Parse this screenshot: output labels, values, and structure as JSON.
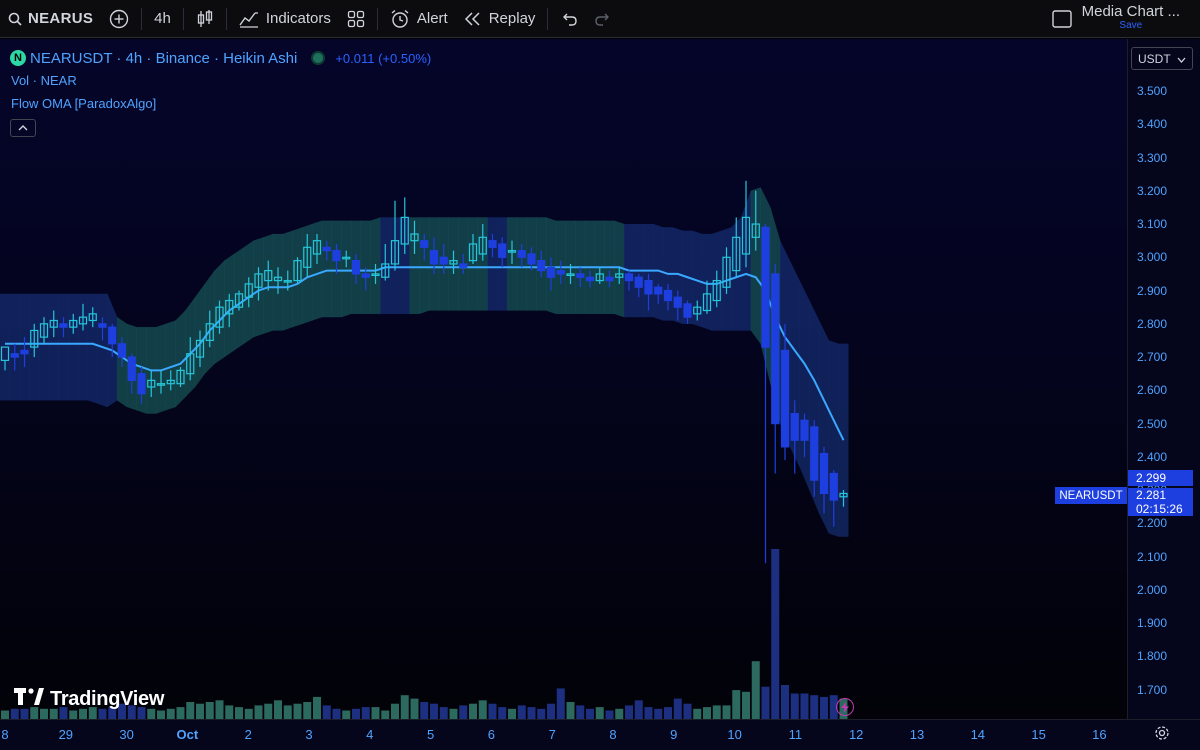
{
  "toolbar": {
    "symbol": "NEARUS",
    "interval": "4h",
    "indicators_label": "Indicators",
    "alert_label": "Alert",
    "replay_label": "Replay",
    "layout_name": "Media Chart ...",
    "save_label": "Save"
  },
  "legend": {
    "title": "NEARUSDT · 4h · Binance · Heikin Ashi",
    "change": "+0.011 (+0.50%)",
    "vol": "Vol · NEAR",
    "indicator": "Flow OMA [ParadoxAlgo]"
  },
  "price_axis": {
    "unit": "USDT",
    "ticks": [
      "3.500",
      "3.400",
      "3.300",
      "3.200",
      "3.100",
      "3.000",
      "2.900",
      "2.800",
      "2.700",
      "2.600",
      "2.500",
      "2.400",
      "2.300",
      "2.200",
      "2.100",
      "2.000",
      "1.900",
      "1.800",
      "1.700"
    ],
    "current_high": "2.299",
    "current_price": "2.281",
    "countdown": "02:15:26",
    "symbol_tag": "NEARUSDT"
  },
  "time_axis": {
    "labels": [
      "8",
      "29",
      "30",
      "Oct",
      "2",
      "3",
      "4",
      "5",
      "6",
      "7",
      "8",
      "9",
      "10",
      "11",
      "12",
      "13",
      "14",
      "15",
      "16"
    ]
  },
  "watermark": "TradingView",
  "colors": {
    "bull": "#26c6da",
    "bear": "#1e3fe0",
    "band_teal": "#1f6f6a",
    "band_blue": "#1c3a8c",
    "accent": "#2962ff"
  },
  "chart_data": {
    "type": "candlestick",
    "price_range": [
      1.65,
      3.56
    ],
    "mid_line": [
      2.74,
      2.74,
      2.74,
      2.74,
      2.74,
      2.74,
      2.74,
      2.74,
      2.74,
      2.74,
      2.73,
      2.72,
      2.7,
      2.68,
      2.67,
      2.66,
      2.66,
      2.67,
      2.68,
      2.71,
      2.74,
      2.78,
      2.81,
      2.84,
      2.86,
      2.88,
      2.9,
      2.91,
      2.91,
      2.91,
      2.92,
      2.94,
      2.95,
      2.96,
      2.96,
      2.96,
      2.96,
      2.96,
      2.96,
      2.97,
      2.97,
      2.97,
      2.97,
      2.97,
      2.97,
      2.97,
      2.97,
      2.97,
      2.97,
      2.97,
      2.97,
      2.97,
      2.97,
      2.97,
      2.97,
      2.97,
      2.97,
      2.97,
      2.97,
      2.97,
      2.97,
      2.97,
      2.97,
      2.97,
      2.96,
      2.96,
      2.96,
      2.96,
      2.95,
      2.95,
      2.94,
      2.93,
      2.92,
      2.92,
      2.93,
      2.94,
      2.95,
      2.94,
      2.9,
      2.82,
      2.76,
      2.72,
      2.68,
      2.63,
      2.57,
      2.51,
      2.45
    ],
    "band_upper": [
      2.89,
      2.89,
      2.89,
      2.89,
      2.89,
      2.89,
      2.89,
      2.89,
      2.89,
      2.89,
      2.89,
      2.89,
      2.82,
      2.8,
      2.79,
      2.79,
      2.79,
      2.8,
      2.81,
      2.84,
      2.88,
      2.92,
      2.96,
      2.99,
      3.01,
      3.03,
      3.05,
      3.06,
      3.07,
      3.07,
      3.08,
      3.09,
      3.1,
      3.11,
      3.11,
      3.11,
      3.11,
      3.11,
      3.11,
      3.12,
      3.12,
      3.12,
      3.12,
      3.12,
      3.12,
      3.12,
      3.12,
      3.12,
      3.12,
      3.12,
      3.12,
      3.12,
      3.12,
      3.12,
      3.12,
      3.12,
      3.12,
      3.11,
      3.11,
      3.11,
      3.11,
      3.11,
      3.11,
      3.11,
      3.1,
      3.1,
      3.1,
      3.1,
      3.09,
      3.09,
      3.08,
      3.08,
      3.07,
      3.07,
      3.08,
      3.09,
      3.12,
      3.2,
      3.21,
      3.15,
      3.05,
      2.99,
      2.93,
      2.87,
      2.81,
      2.75,
      2.74
    ],
    "band_lower": [
      2.57,
      2.57,
      2.57,
      2.57,
      2.57,
      2.57,
      2.57,
      2.57,
      2.57,
      2.57,
      2.56,
      2.55,
      2.57,
      2.55,
      2.54,
      2.53,
      2.53,
      2.54,
      2.55,
      2.58,
      2.61,
      2.65,
      2.68,
      2.7,
      2.72,
      2.74,
      2.76,
      2.77,
      2.78,
      2.78,
      2.79,
      2.8,
      2.81,
      2.82,
      2.82,
      2.82,
      2.83,
      2.83,
      2.83,
      2.83,
      2.83,
      2.83,
      2.83,
      2.83,
      2.84,
      2.84,
      2.84,
      2.84,
      2.84,
      2.84,
      2.84,
      2.84,
      2.84,
      2.84,
      2.84,
      2.84,
      2.84,
      2.83,
      2.83,
      2.83,
      2.83,
      2.83,
      2.83,
      2.83,
      2.82,
      2.82,
      2.82,
      2.82,
      2.81,
      2.81,
      2.8,
      2.8,
      2.79,
      2.78,
      2.78,
      2.78,
      2.78,
      2.78,
      2.74,
      2.62,
      2.5,
      2.43,
      2.37,
      2.3,
      2.23,
      2.17,
      2.16
    ],
    "band_colors": [
      "blue",
      "blue",
      "blue",
      "blue",
      "blue",
      "blue",
      "blue",
      "blue",
      "blue",
      "blue",
      "blue",
      "blue",
      "teal",
      "teal",
      "teal",
      "teal",
      "teal",
      "teal",
      "teal",
      "teal",
      "teal",
      "teal",
      "teal",
      "teal",
      "teal",
      "teal",
      "teal",
      "teal",
      "teal",
      "teal",
      "teal",
      "teal",
      "teal",
      "teal",
      "teal",
      "teal",
      "teal",
      "teal",
      "teal",
      "blue",
      "blue",
      "blue",
      "teal",
      "teal",
      "teal",
      "teal",
      "teal",
      "teal",
      "teal",
      "teal",
      "blue",
      "blue",
      "teal",
      "teal",
      "teal",
      "teal",
      "teal",
      "teal",
      "teal",
      "teal",
      "teal",
      "teal",
      "teal",
      "teal",
      "blue",
      "blue",
      "blue",
      "blue",
      "blue",
      "blue",
      "blue",
      "blue",
      "blue",
      "blue",
      "blue",
      "blue",
      "blue",
      "teal",
      "teal",
      "teal",
      "blue",
      "blue",
      "blue",
      "blue",
      "blue",
      "blue",
      "blue",
      "blue"
    ],
    "candles": [
      [
        2.69,
        2.73,
        2.66,
        2.69
      ],
      [
        2.71,
        2.7,
        2.66,
        2.74
      ],
      [
        2.72,
        2.71,
        2.67,
        2.76
      ],
      [
        2.73,
        2.78,
        2.7,
        2.8
      ],
      [
        2.76,
        2.8,
        2.74,
        2.82
      ],
      [
        2.79,
        2.81,
        2.76,
        2.84
      ],
      [
        2.8,
        2.79,
        2.76,
        2.82
      ],
      [
        2.79,
        2.81,
        2.77,
        2.83
      ],
      [
        2.8,
        2.82,
        2.78,
        2.86
      ],
      [
        2.81,
        2.83,
        2.79,
        2.85
      ],
      [
        2.8,
        2.79,
        2.75,
        2.82
      ],
      [
        2.79,
        2.74,
        2.7,
        2.8
      ],
      [
        2.74,
        2.7,
        2.67,
        2.76
      ],
      [
        2.7,
        2.63,
        2.59,
        2.71
      ],
      [
        2.65,
        2.59,
        2.56,
        2.67
      ],
      [
        2.61,
        2.63,
        2.58,
        2.66
      ],
      [
        2.62,
        2.62,
        2.59,
        2.66
      ],
      [
        2.62,
        2.63,
        2.6,
        2.66
      ],
      [
        2.62,
        2.66,
        2.61,
        2.67
      ],
      [
        2.65,
        2.71,
        2.63,
        2.76
      ],
      [
        2.7,
        2.75,
        2.67,
        2.78
      ],
      [
        2.75,
        2.8,
        2.73,
        2.84
      ],
      [
        2.79,
        2.85,
        2.77,
        2.87
      ],
      [
        2.83,
        2.87,
        2.79,
        2.89
      ],
      [
        2.85,
        2.89,
        2.84,
        2.9
      ],
      [
        2.88,
        2.92,
        2.85,
        2.94
      ],
      [
        2.91,
        2.95,
        2.87,
        2.97
      ],
      [
        2.93,
        2.96,
        2.9,
        2.99
      ],
      [
        2.93,
        2.94,
        2.89,
        2.97
      ],
      [
        2.93,
        2.93,
        2.9,
        2.96
      ],
      [
        2.93,
        2.99,
        2.92,
        3.0
      ],
      [
        2.97,
        3.03,
        2.94,
        3.07
      ],
      [
        3.01,
        3.05,
        2.98,
        3.07
      ],
      [
        3.03,
        3.02,
        2.99,
        3.05
      ],
      [
        3.02,
        2.99,
        2.95,
        3.04
      ],
      [
        3.0,
        3.0,
        2.97,
        3.02
      ],
      [
        2.99,
        2.95,
        2.92,
        3.01
      ],
      [
        2.95,
        2.94,
        2.9,
        2.97
      ],
      [
        2.95,
        2.95,
        2.92,
        2.98
      ],
      [
        2.94,
        2.98,
        2.93,
        3.04
      ],
      [
        2.98,
        3.05,
        2.96,
        3.17
      ],
      [
        3.04,
        3.12,
        3.01,
        3.18
      ],
      [
        3.05,
        3.07,
        3.01,
        3.11
      ],
      [
        3.05,
        3.03,
        2.99,
        3.07
      ],
      [
        3.02,
        2.98,
        2.95,
        3.06
      ],
      [
        3.0,
        2.98,
        2.95,
        3.04
      ],
      [
        2.98,
        2.99,
        2.95,
        3.02
      ],
      [
        2.98,
        2.97,
        2.95,
        3.01
      ],
      [
        2.99,
        3.04,
        2.98,
        3.07
      ],
      [
        3.01,
        3.06,
        2.99,
        3.1
      ],
      [
        3.05,
        3.03,
        3.0,
        3.07
      ],
      [
        3.04,
        3.0,
        2.97,
        3.06
      ],
      [
        3.02,
        3.02,
        2.98,
        3.05
      ],
      [
        3.02,
        3.0,
        2.97,
        3.04
      ],
      [
        3.01,
        2.98,
        2.96,
        3.03
      ],
      [
        2.99,
        2.96,
        2.94,
        3.02
      ],
      [
        2.97,
        2.94,
        2.9,
        3.0
      ],
      [
        2.96,
        2.95,
        2.92,
        2.99
      ],
      [
        2.95,
        2.95,
        2.92,
        2.98
      ],
      [
        2.95,
        2.94,
        2.91,
        2.97
      ],
      [
        2.94,
        2.93,
        2.91,
        2.96
      ],
      [
        2.93,
        2.95,
        2.92,
        2.97
      ],
      [
        2.94,
        2.93,
        2.91,
        2.96
      ],
      [
        2.94,
        2.95,
        2.92,
        2.97
      ],
      [
        2.95,
        2.93,
        2.9,
        2.96
      ],
      [
        2.94,
        2.91,
        2.88,
        2.95
      ],
      [
        2.93,
        2.89,
        2.84,
        2.95
      ],
      [
        2.91,
        2.89,
        2.86,
        2.92
      ],
      [
        2.9,
        2.87,
        2.84,
        2.92
      ],
      [
        2.88,
        2.85,
        2.81,
        2.9
      ],
      [
        2.86,
        2.82,
        2.8,
        2.87
      ],
      [
        2.83,
        2.85,
        2.81,
        2.87
      ],
      [
        2.84,
        2.89,
        2.83,
        2.93
      ],
      [
        2.87,
        2.93,
        2.85,
        2.96
      ],
      [
        2.91,
        3.0,
        2.89,
        3.03
      ],
      [
        2.96,
        3.06,
        2.94,
        3.12
      ],
      [
        3.01,
        3.12,
        2.97,
        3.23
      ],
      [
        3.06,
        3.1,
        3.02,
        3.2
      ],
      [
        3.09,
        2.73,
        2.08,
        3.1
      ],
      [
        2.95,
        2.5,
        2.35,
        2.98
      ],
      [
        2.72,
        2.43,
        2.39,
        2.8
      ],
      [
        2.53,
        2.45,
        2.35,
        2.57
      ],
      [
        2.51,
        2.45,
        2.4,
        2.53
      ],
      [
        2.49,
        2.33,
        2.28,
        2.51
      ],
      [
        2.41,
        2.29,
        2.23,
        2.43
      ],
      [
        2.35,
        2.27,
        2.19,
        2.36
      ],
      [
        2.28,
        2.29,
        2.25,
        2.3
      ]
    ],
    "volume": [
      0.05,
      0.06,
      0.06,
      0.07,
      0.06,
      0.06,
      0.07,
      0.05,
      0.06,
      0.07,
      0.06,
      0.07,
      0.09,
      0.08,
      0.07,
      0.06,
      0.05,
      0.06,
      0.07,
      0.1,
      0.09,
      0.1,
      0.11,
      0.08,
      0.07,
      0.06,
      0.08,
      0.09,
      0.11,
      0.08,
      0.09,
      0.1,
      0.13,
      0.08,
      0.06,
      0.05,
      0.06,
      0.07,
      0.07,
      0.05,
      0.09,
      0.14,
      0.12,
      0.1,
      0.09,
      0.07,
      0.06,
      0.08,
      0.09,
      0.11,
      0.09,
      0.07,
      0.06,
      0.08,
      0.07,
      0.06,
      0.09,
      0.18,
      0.1,
      0.08,
      0.06,
      0.07,
      0.05,
      0.06,
      0.08,
      0.11,
      0.07,
      0.06,
      0.07,
      0.12,
      0.09,
      0.06,
      0.07,
      0.08,
      0.08,
      0.17,
      0.16,
      0.34,
      0.19,
      1.0,
      0.2,
      0.15,
      0.15,
      0.14,
      0.13,
      0.14,
      0.12
    ]
  }
}
